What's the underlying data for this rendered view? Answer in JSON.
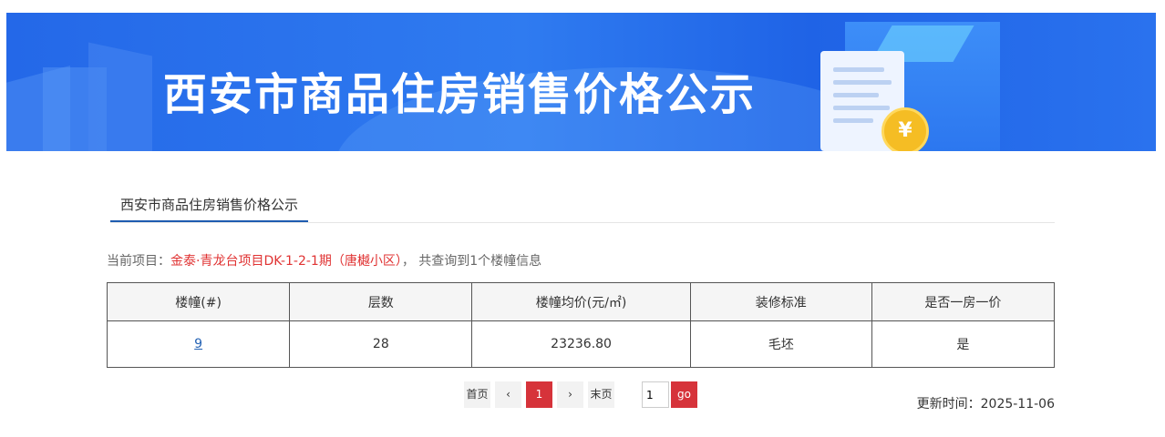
{
  "banner": {
    "title": "西安市商品住房销售价格公示",
    "coin_symbol": "¥"
  },
  "tabs": [
    {
      "label": "西安市商品住房销售价格公示",
      "active": true
    }
  ],
  "info": {
    "prefix": "当前项目：",
    "project": "金泰·青龙台项目DK-1-2-1期（唐樾小区）",
    "suffix": "， 共查询到1个楼幢信息"
  },
  "table": {
    "headers": [
      "楼幢(#)",
      "层数",
      "楼幢均价(元/㎡)",
      "装修标准",
      "是否一房一价"
    ],
    "rows": [
      [
        "9",
        "28",
        "23236.80",
        "毛坯",
        "是"
      ]
    ]
  },
  "pagination": {
    "first": "首页",
    "prev": "‹",
    "current": "1",
    "next": "›",
    "last": "末页",
    "jump_value": "1",
    "go": "go"
  },
  "update": {
    "label": "更新时间：",
    "date": "2025-11-06"
  },
  "colors": {
    "banner_blue": "#2468e8",
    "accent_red": "#d6333a",
    "tab_underline": "#1e5cb0",
    "project_red": "#e03333"
  }
}
